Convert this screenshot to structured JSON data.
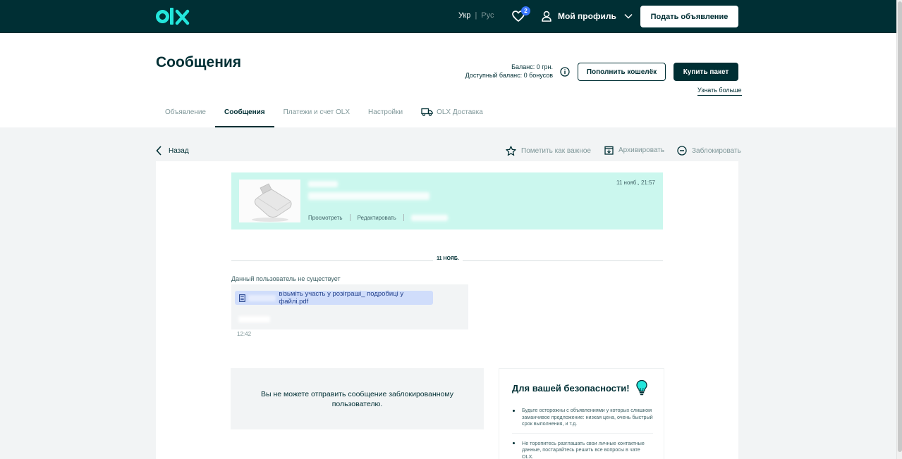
{
  "topbar": {
    "lang_ukr": "Укр",
    "lang_sep": "|",
    "lang_rus": "Рус",
    "favorites_count": "2",
    "profile_label": "Мой профиль",
    "post_button": "Подать объявление",
    "brand_color": "#002f34",
    "logo_accent": "#23e5db",
    "icons": [
      "olx-logo",
      "heart-icon",
      "user-icon",
      "chevron-down-icon"
    ]
  },
  "header": {
    "title": "Сообщения",
    "balance_line1": "Баланс: 0 грн.",
    "balance_line2": "Доступный баланс: 0 бонусов",
    "topup_button": "Пополнить кошелёк",
    "buy_button": "Купить пакет",
    "learn_more": "Узнать больше"
  },
  "tabs": [
    {
      "label": "Объявление",
      "active": false
    },
    {
      "label": "Сообщения",
      "active": true
    },
    {
      "label": "Платежи и счет OLX",
      "active": false
    },
    {
      "label": "Настройки",
      "active": false
    },
    {
      "label": "OLX Доставка",
      "active": false
    }
  ],
  "actions": {
    "back": "Назад",
    "mark_important": "Пометить как важное",
    "archive": "Архивировать",
    "block": "Заблокировать"
  },
  "ad": {
    "time": "11 нояб., 21:57",
    "view_link": "Просмотреть",
    "edit_link": "Редактировать",
    "card_color": "#cbf7ee"
  },
  "chat": {
    "date_label": "11 НОЯБ.",
    "user_not_exist": "Данный пользователь не существует",
    "file_name": "візьміть участь у розіграші_ подробиці у файлі.pdf",
    "message_time": "12:42"
  },
  "blocked_notice": "Вы не можете отправить сообщение заблокированному пользователю.",
  "safety": {
    "title": "Для вашей безопасности!",
    "tips": [
      "Будьте осторожны с объявлениями у которых слишком заманчивое предложение: низкая цена, очень быстрый срок выполнения, и т.д.",
      "Не торопитесь разглашать свои личные контактные данные, постарайтесь решить все вопросы в чате OLX."
    ]
  }
}
